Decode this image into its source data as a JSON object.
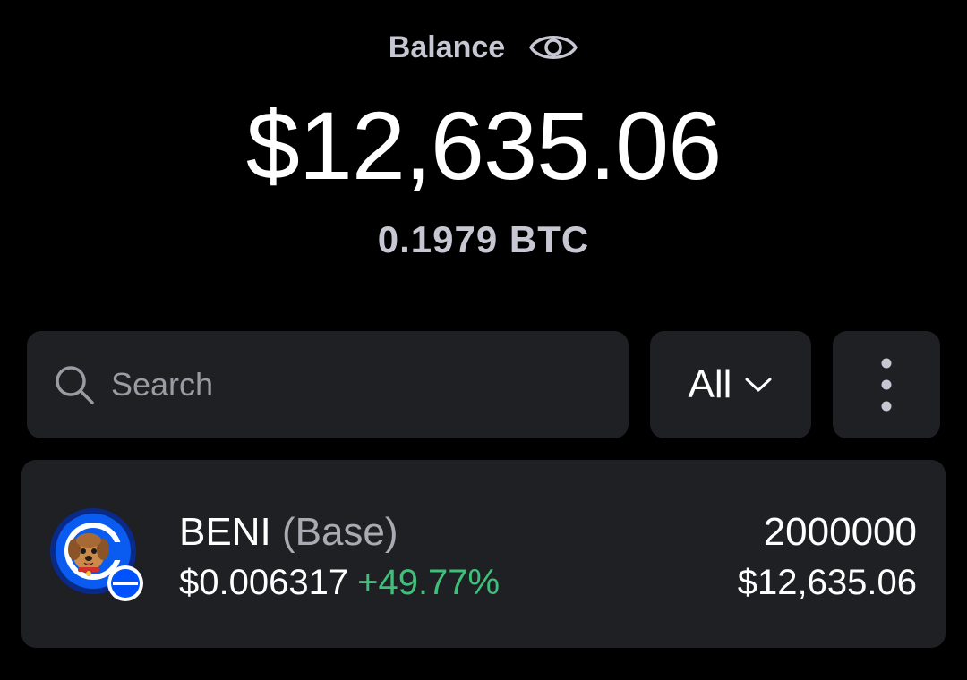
{
  "balance": {
    "label": "Balance",
    "amount": "$12,635.06",
    "btc": "0.1979 BTC"
  },
  "search": {
    "placeholder": "Search",
    "value": ""
  },
  "filter": {
    "label": "All"
  },
  "tokens": [
    {
      "symbol": "BENI",
      "network": "(Base)",
      "price": "$0.006317",
      "change": "+49.77%",
      "amount": "2000000",
      "value": "$12,635.06"
    }
  ],
  "colors": {
    "background": "#000000",
    "panel": "#1f2023",
    "positive": "#3ec07a",
    "muted_text": "#c7c7d3",
    "base_blue": "#0052ff"
  },
  "icons": {
    "visibility": "eye-icon",
    "search": "search-icon",
    "filter_dropdown": "chevron-down-icon",
    "menu": "more-vertical-icon",
    "network_badge": "base-network-badge-icon"
  }
}
